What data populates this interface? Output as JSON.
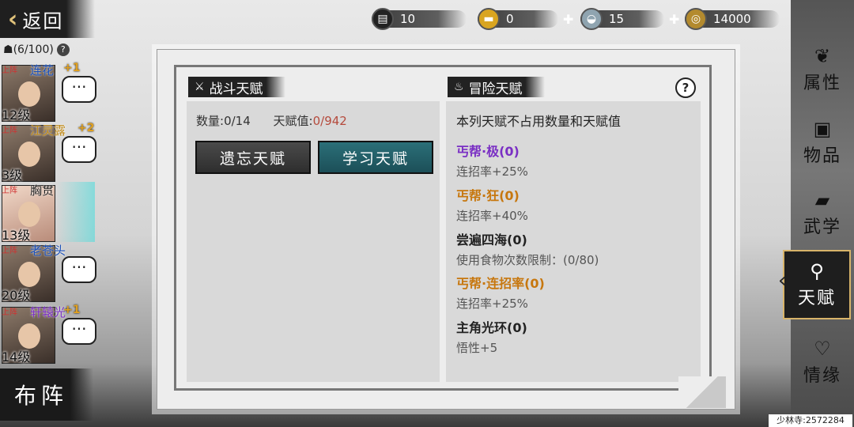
{
  "back": {
    "label": "返回"
  },
  "resources": [
    {
      "icon": "cart-icon",
      "value": "10",
      "has_plus": false
    },
    {
      "icon": "gold-ingot-icon",
      "value": "0",
      "has_plus": true
    },
    {
      "icon": "silver-ingot-icon",
      "value": "15",
      "has_plus": true
    },
    {
      "icon": "coin-icon",
      "value": "14000",
      "has_plus": false
    }
  ],
  "roster": {
    "capacity": "(6/100)",
    "help": "?",
    "heroes": [
      {
        "tag": "上阵",
        "name": "连花",
        "bonus": "+1",
        "level": "12级"
      },
      {
        "tag": "上阵",
        "name": "江灵露",
        "bonus": "+2",
        "level": "3级"
      },
      {
        "tag": "上阵",
        "name": "胸贯",
        "bonus": "",
        "level": "13级"
      },
      {
        "tag": "上阵",
        "name": "老苍头",
        "bonus": "",
        "level": "20级"
      },
      {
        "tag": "上阵",
        "name": "轩辕光",
        "bonus": "+1",
        "level": "14级"
      }
    ],
    "chat_glyph": "···",
    "formation_label": "布阵"
  },
  "nav": [
    {
      "label": "属性",
      "icon": "bird-icon"
    },
    {
      "label": "物品",
      "icon": "chest-icon"
    },
    {
      "label": "武学",
      "icon": "book-icon"
    },
    {
      "label": "天赋",
      "icon": "talent-icon",
      "active": true
    },
    {
      "label": "情缘",
      "icon": "heart-icon"
    }
  ],
  "combat": {
    "title": "战斗天赋",
    "count_label": "数量:",
    "count_value": "0/14",
    "points_label": "天赋值:",
    "points_value": "0/942",
    "forget_button": "遗忘天赋",
    "learn_button": "学习天赋"
  },
  "adventure": {
    "title": "冒险天赋",
    "help": "?",
    "note": "本列天赋不占用数量和天赋值",
    "talents": [
      {
        "name": "丐帮·极(0)",
        "desc": "连招率+25%",
        "color": "#7a2fc4"
      },
      {
        "name": "丐帮·狂(0)",
        "desc": "连招率+40%",
        "color": "#c7770e"
      },
      {
        "name": "尝遍四海(0)",
        "desc": "使用食物次数限制：(0/80)",
        "color": "#222222"
      },
      {
        "name": "丐帮·连招率(0)",
        "desc": "连招率+25%",
        "color": "#c7770e"
      },
      {
        "name": "主角光环(0)",
        "desc": "悟性+5",
        "color": "#222222"
      }
    ]
  },
  "footer": "少林寺:2572284"
}
